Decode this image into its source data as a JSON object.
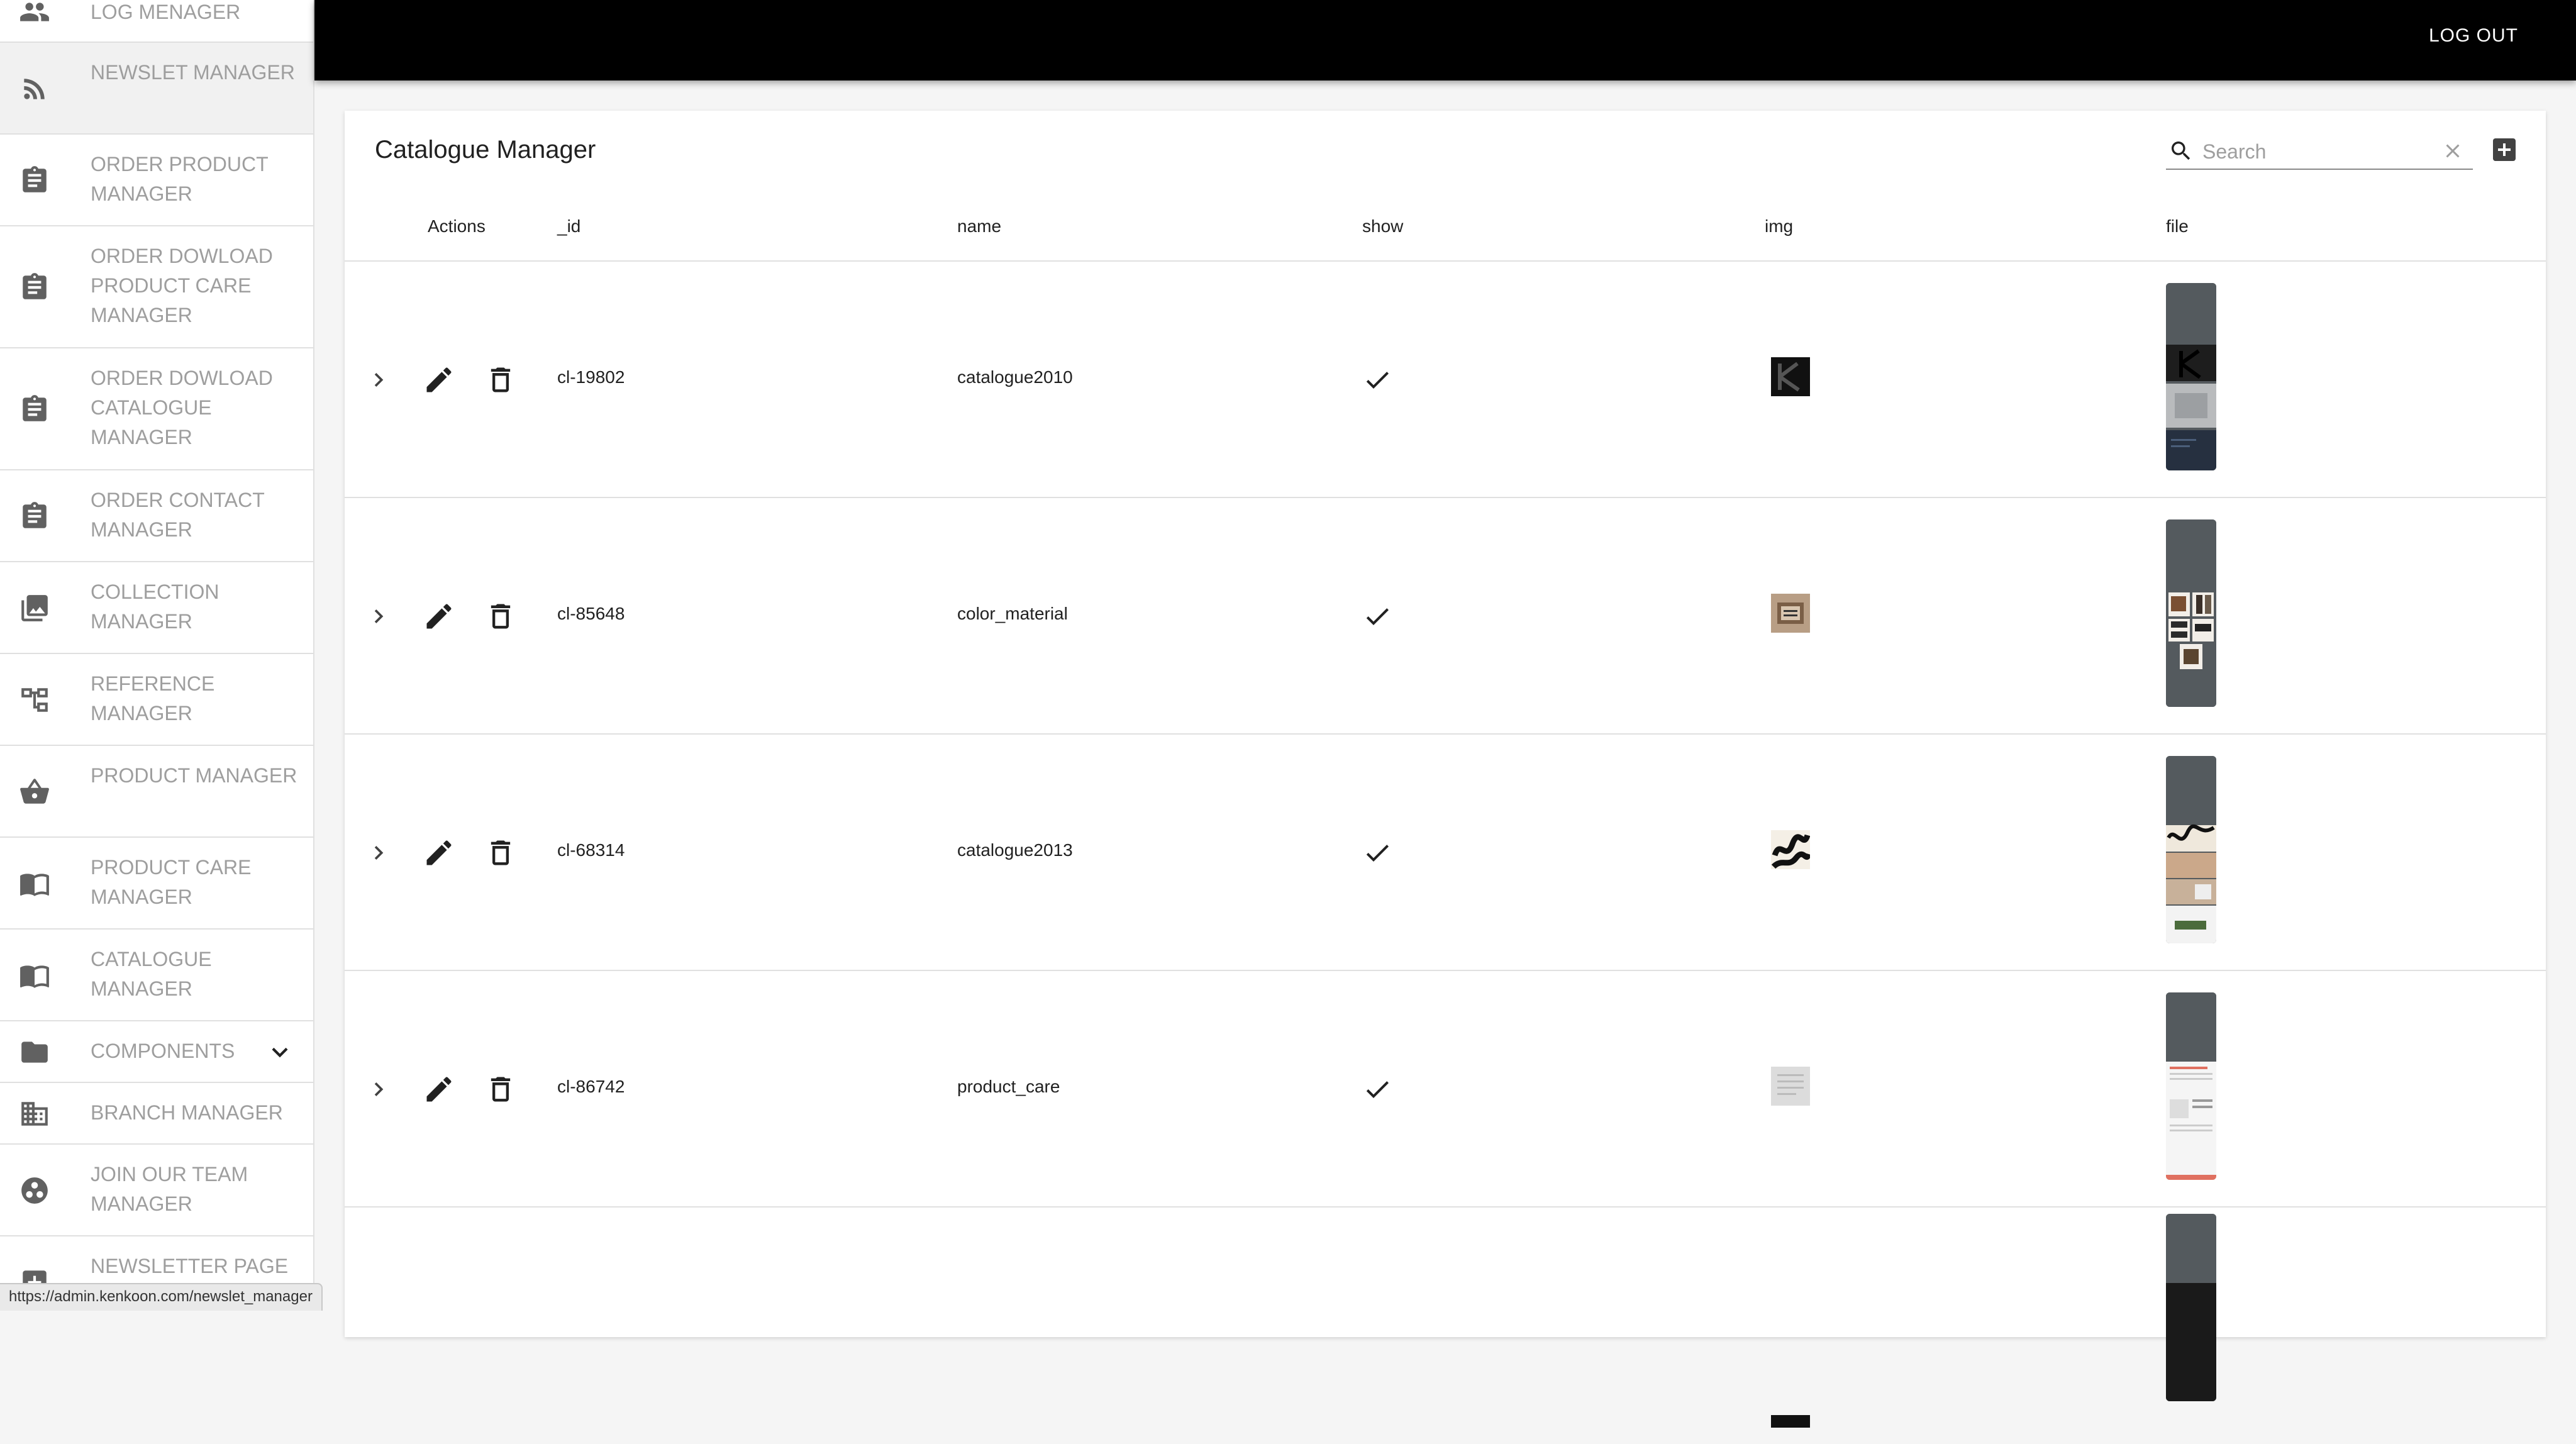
{
  "sidebar": {
    "items": [
      {
        "label": "LOG MENAGER",
        "icon": "people-icon"
      },
      {
        "label": "NEWSLET MANAGER",
        "icon": "rss-icon"
      },
      {
        "label": "ORDER PRODUCT MANAGER",
        "icon": "clipboard-icon"
      },
      {
        "label": "ORDER DOWLOAD PRODUCT CARE MANAGER",
        "icon": "clipboard-icon"
      },
      {
        "label": "ORDER DOWLOAD CATALOGUE MANAGER",
        "icon": "clipboard-icon"
      },
      {
        "label": "ORDER CONTACT MANAGER",
        "icon": "clipboard-icon"
      },
      {
        "label": "COLLECTION MANAGER",
        "icon": "photo-library-icon"
      },
      {
        "label": "REFERENCE MANAGER",
        "icon": "account-tree-icon"
      },
      {
        "label": "PRODUCT MANAGER",
        "icon": "basket-icon"
      },
      {
        "label": "PRODUCT CARE MANAGER",
        "icon": "book-icon"
      },
      {
        "label": "CATALOGUE MANAGER",
        "icon": "book-icon"
      },
      {
        "label": "COMPONENTS",
        "icon": "folder-icon"
      },
      {
        "label": "BRANCH MANAGER",
        "icon": "building-icon"
      },
      {
        "label": "JOIN OUR TEAM MANAGER",
        "icon": "group-work-icon"
      },
      {
        "label": "NEWSLETTER PAGE",
        "icon": "add-box-icon"
      }
    ]
  },
  "topbar": {
    "logout_label": "LOG OUT"
  },
  "card": {
    "title": "Catalogue Manager",
    "search": {
      "placeholder": "Search",
      "value": ""
    }
  },
  "table": {
    "columns": [
      "Actions",
      "_id",
      "name",
      "show",
      "img",
      "file"
    ],
    "rows": [
      {
        "_id": "cl-19802",
        "name": "catalogue2010",
        "show": true
      },
      {
        "_id": "cl-85648",
        "name": "color_material",
        "show": true
      },
      {
        "_id": "cl-68314",
        "name": "catalogue2013",
        "show": true
      },
      {
        "_id": "cl-86742",
        "name": "product_care",
        "show": true
      }
    ]
  },
  "statusbar": {
    "url": "https://admin.kenkoon.com/newslet_manager"
  },
  "colors": {
    "topbar": "#000000",
    "sidebar_text": "#9e9e9e",
    "icon": "#616161"
  }
}
